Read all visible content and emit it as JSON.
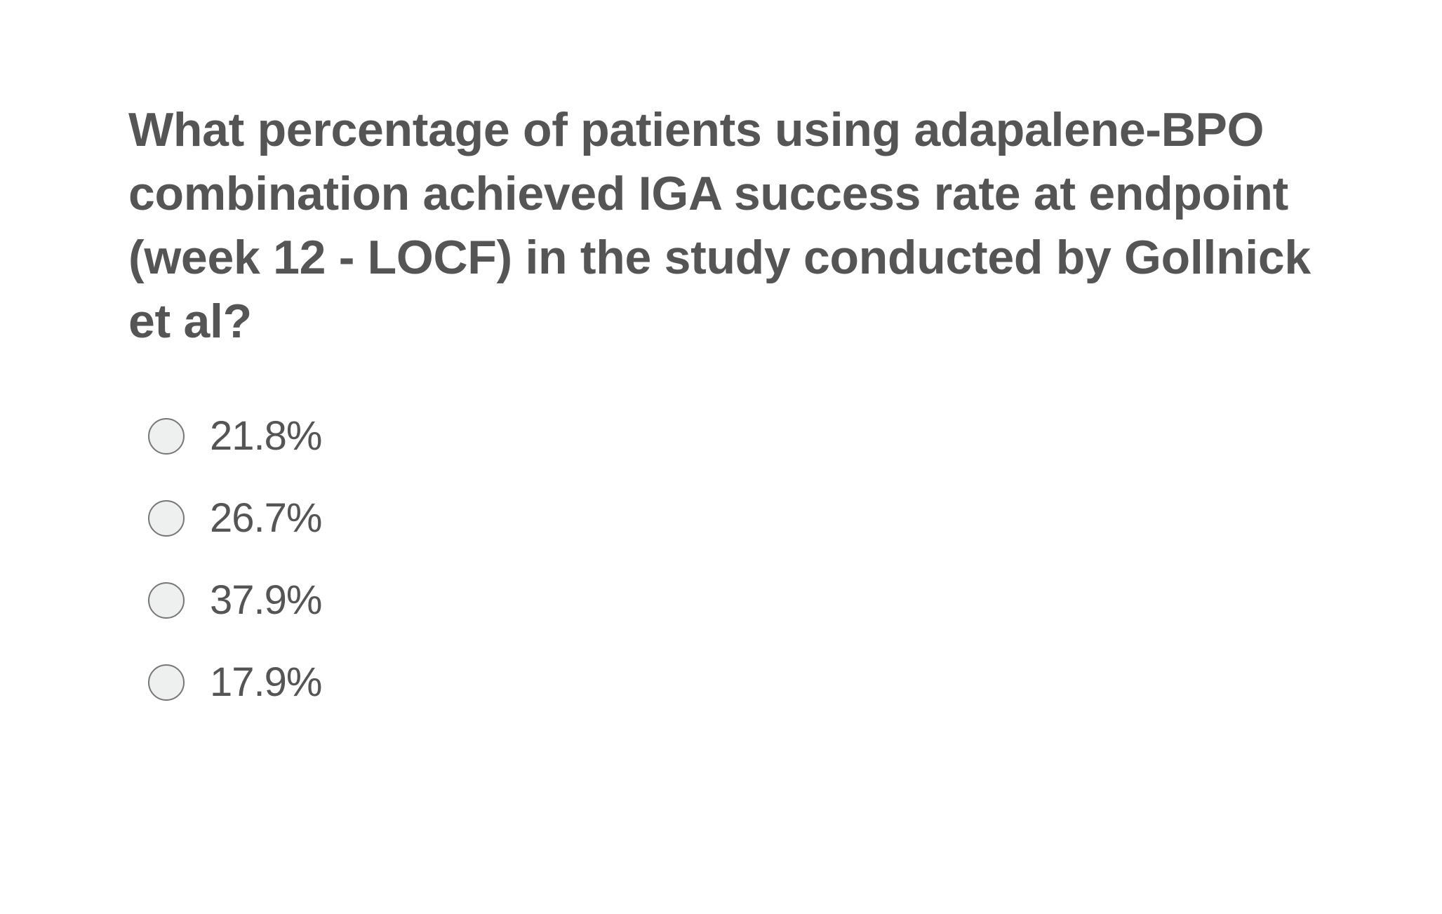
{
  "question": {
    "text": "What percentage of patients using adapalene-BPO combination achieved IGA success rate at endpoint (week 12 - LOCF) in the study conducted by Gollnick et al?"
  },
  "options": [
    {
      "label": "21.8%",
      "selected": false
    },
    {
      "label": "26.7%",
      "selected": false
    },
    {
      "label": "37.9%",
      "selected": false
    },
    {
      "label": "17.9%",
      "selected": false
    }
  ],
  "colors": {
    "text": "#555555",
    "radio_fill": "#eef0ef",
    "radio_border": "#777777",
    "background": "#ffffff"
  }
}
